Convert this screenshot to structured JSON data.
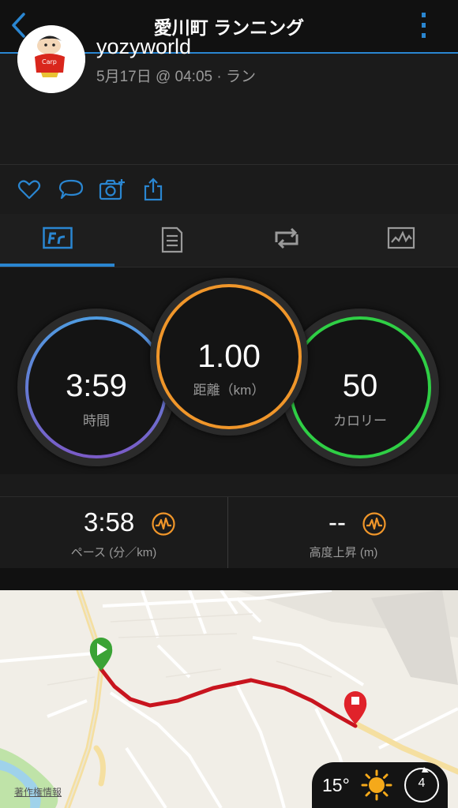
{
  "header": {
    "title": "愛川町 ランニング"
  },
  "profile": {
    "username": "yozyworld",
    "meta": "5月17日 @ 04:05 · ラン"
  },
  "tabs": [
    "summary-tab",
    "details-tab",
    "laps-tab",
    "charts-tab"
  ],
  "stats": {
    "time": {
      "value": "3:59",
      "label": "時間"
    },
    "distance": {
      "value": "1.00",
      "label": "距離（km）"
    },
    "calories": {
      "value": "50",
      "label": "カロリー"
    }
  },
  "pace": {
    "value": "3:58",
    "label": "ペース (分／km)"
  },
  "elevation": {
    "value": "--",
    "label": "高度上昇 (m)"
  },
  "map": {
    "credit": "著作権情報"
  },
  "weather": {
    "temp": "15°",
    "wind": "4"
  },
  "colors": {
    "accent": "#2a86d1",
    "time_ring": "#5a7fd6",
    "distance_ring": "#f0962a",
    "calories_ring": "#2fcf45",
    "route": "#c8141e"
  }
}
